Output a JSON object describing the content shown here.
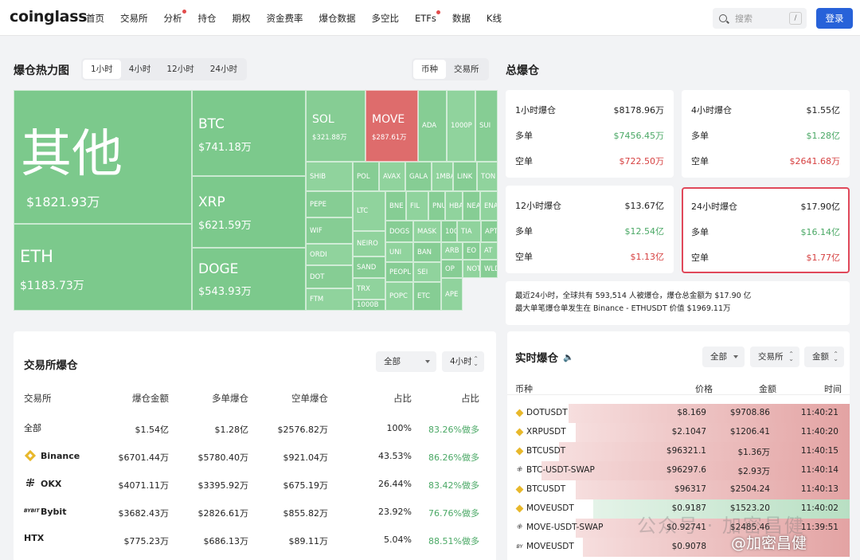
{
  "nav": {
    "logo": "coinglass",
    "items": [
      "首页",
      "交易所",
      "分析",
      "持仓",
      "期权",
      "资金费率",
      "爆仓数据",
      "多空比",
      "ETFs",
      "数据",
      "K线"
    ],
    "search_placeholder": "搜索",
    "search_shortcut": "/",
    "login": "登录"
  },
  "heatmap": {
    "title": "爆仓热力图",
    "time_tabs": [
      "1小时",
      "4小时",
      "12小时",
      "24小时"
    ],
    "mode_tabs": [
      "币种",
      "交易所"
    ],
    "big": [
      {
        "name": "其他",
        "value": "$1821.93万"
      },
      {
        "name": "ETH",
        "value": "$1183.73万"
      },
      {
        "name": "BTC",
        "value": "$741.18万"
      },
      {
        "name": "XRP",
        "value": "$621.59万"
      },
      {
        "name": "DOGE",
        "value": "$543.93万"
      },
      {
        "name": "SOL",
        "value": "$321.88万"
      },
      {
        "name": "MOVE",
        "value": "$287.61万"
      }
    ],
    "small": [
      "ADA",
      "1000P",
      "SUI",
      "SHIB",
      "POL",
      "AVAX",
      "GALA",
      "1MBA",
      "LINK",
      "TON",
      "PEPE",
      "LTC",
      "BNE",
      "FIL",
      "PNU",
      "HBA",
      "NEA",
      "ENA",
      "WIF",
      "NEIRO",
      "DOGS",
      "MASK",
      "100",
      "TIA",
      "APT",
      "ORDI",
      "SAND",
      "UNI",
      "BAN",
      "ARB",
      "EO",
      "AT",
      "DOT",
      "TRX",
      "PEOPL",
      "SEI",
      "OP",
      "NOT",
      "WLD",
      "FTM",
      "1000B",
      "POPC",
      "ETC",
      "APE"
    ]
  },
  "total": {
    "title": "总爆仓",
    "long_label": "多单",
    "short_label": "空单",
    "cards": [
      {
        "label": "1小时爆仓",
        "total": "$8178.96万",
        "long": "$7456.45万",
        "short": "$722.50万"
      },
      {
        "label": "4小时爆仓",
        "total": "$1.55亿",
        "long": "$1.28亿",
        "short": "$2641.68万"
      },
      {
        "label": "12小时爆仓",
        "total": "$13.67亿",
        "long": "$12.54亿",
        "short": "$1.13亿"
      },
      {
        "label": "24小时爆仓",
        "total": "$17.90亿",
        "long": "$16.14亿",
        "short": "$1.77亿"
      }
    ],
    "summary_line1": "最近24小时，全球共有 593,514 人被爆仓，爆仓总金额为 $17.90 亿",
    "summary_line2": "最大单笔爆仓单发生在 Binance - ETHUSDT 价值 $1969.11万"
  },
  "exchange": {
    "title": "交易所爆仓",
    "filter": "全部",
    "period": "4小时",
    "headers": [
      "交易所",
      "爆仓金额",
      "多单爆仓",
      "空单爆仓",
      "占比",
      "占比"
    ],
    "rows": [
      {
        "name": "全部",
        "icon": "",
        "amount": "$1.54亿",
        "long": "$1.28亿",
        "short": "$2576.82万",
        "share": "100%",
        "ratio": "83.26%做多"
      },
      {
        "name": "Binance",
        "icon": "binance-icon",
        "amount": "$6701.44万",
        "long": "$5780.40万",
        "short": "$921.04万",
        "share": "43.53%",
        "ratio": "86.26%做多"
      },
      {
        "name": "OKX",
        "icon": "okx-icon",
        "amount": "$4071.11万",
        "long": "$3395.92万",
        "short": "$675.19万",
        "share": "26.44%",
        "ratio": "83.42%做多"
      },
      {
        "name": "Bybit",
        "icon": "bybit-icon",
        "amount": "$3682.43万",
        "long": "$2826.61万",
        "short": "$855.82万",
        "share": "23.92%",
        "ratio": "76.76%做多"
      },
      {
        "name": "HTX",
        "icon": "",
        "amount": "$775.23万",
        "long": "$686.13万",
        "short": "$89.11万",
        "share": "5.04%",
        "ratio": "88.51%做多"
      }
    ]
  },
  "realtime": {
    "title": "实时爆仓",
    "filters": [
      "全部",
      "交易所",
      "金额"
    ],
    "headers": [
      "币种",
      "价格",
      "金额",
      "时间"
    ],
    "rows": [
      {
        "icon": "bn",
        "symbol": "DOTUSDT",
        "price": "$8.169",
        "amount": "$9708.86",
        "time": "11:40:21",
        "side": "red",
        "fill": 0.82
      },
      {
        "icon": "bn",
        "symbol": "XRPUSDT",
        "price": "$2.1047",
        "amount": "$1206.41",
        "time": "11:40:20",
        "side": "red",
        "fill": 0.8
      },
      {
        "icon": "bn",
        "symbol": "BTCUSDT",
        "price": "$96321.1",
        "amount": "$1.36万",
        "time": "11:40:15",
        "side": "red",
        "fill": 0.85
      },
      {
        "icon": "okx",
        "symbol": "BTC-USDT-SWAP",
        "price": "$96297.6",
        "amount": "$2.93万",
        "time": "11:40:14",
        "side": "red",
        "fill": 0.9
      },
      {
        "icon": "bn",
        "symbol": "BTCUSDT",
        "price": "$96317",
        "amount": "$2504.24",
        "time": "11:40:13",
        "side": "red",
        "fill": 0.8
      },
      {
        "icon": "bn",
        "symbol": "MOVEUSDT",
        "price": "$0.9187",
        "amount": "$1523.20",
        "time": "11:40:02",
        "side": "green",
        "fill": 0.75
      },
      {
        "icon": "okx",
        "symbol": "MOVE-USDT-SWAP",
        "price": "$0.92741",
        "amount": "$2485.46",
        "time": "11:39:51",
        "side": "red",
        "fill": 0.8
      },
      {
        "icon": "bybit",
        "symbol": "MOVEUSDT",
        "price": "$0.9078",
        "amount": "",
        "time": "",
        "side": "red",
        "fill": 0.78
      }
    ]
  },
  "watermark": "公众号 · 加密昌健",
  "watermark2": "@加密昌健",
  "colors": {
    "accent": "#2762d9",
    "green": "#4aa865",
    "red": "#d64141",
    "highlight": "#e0485a"
  }
}
